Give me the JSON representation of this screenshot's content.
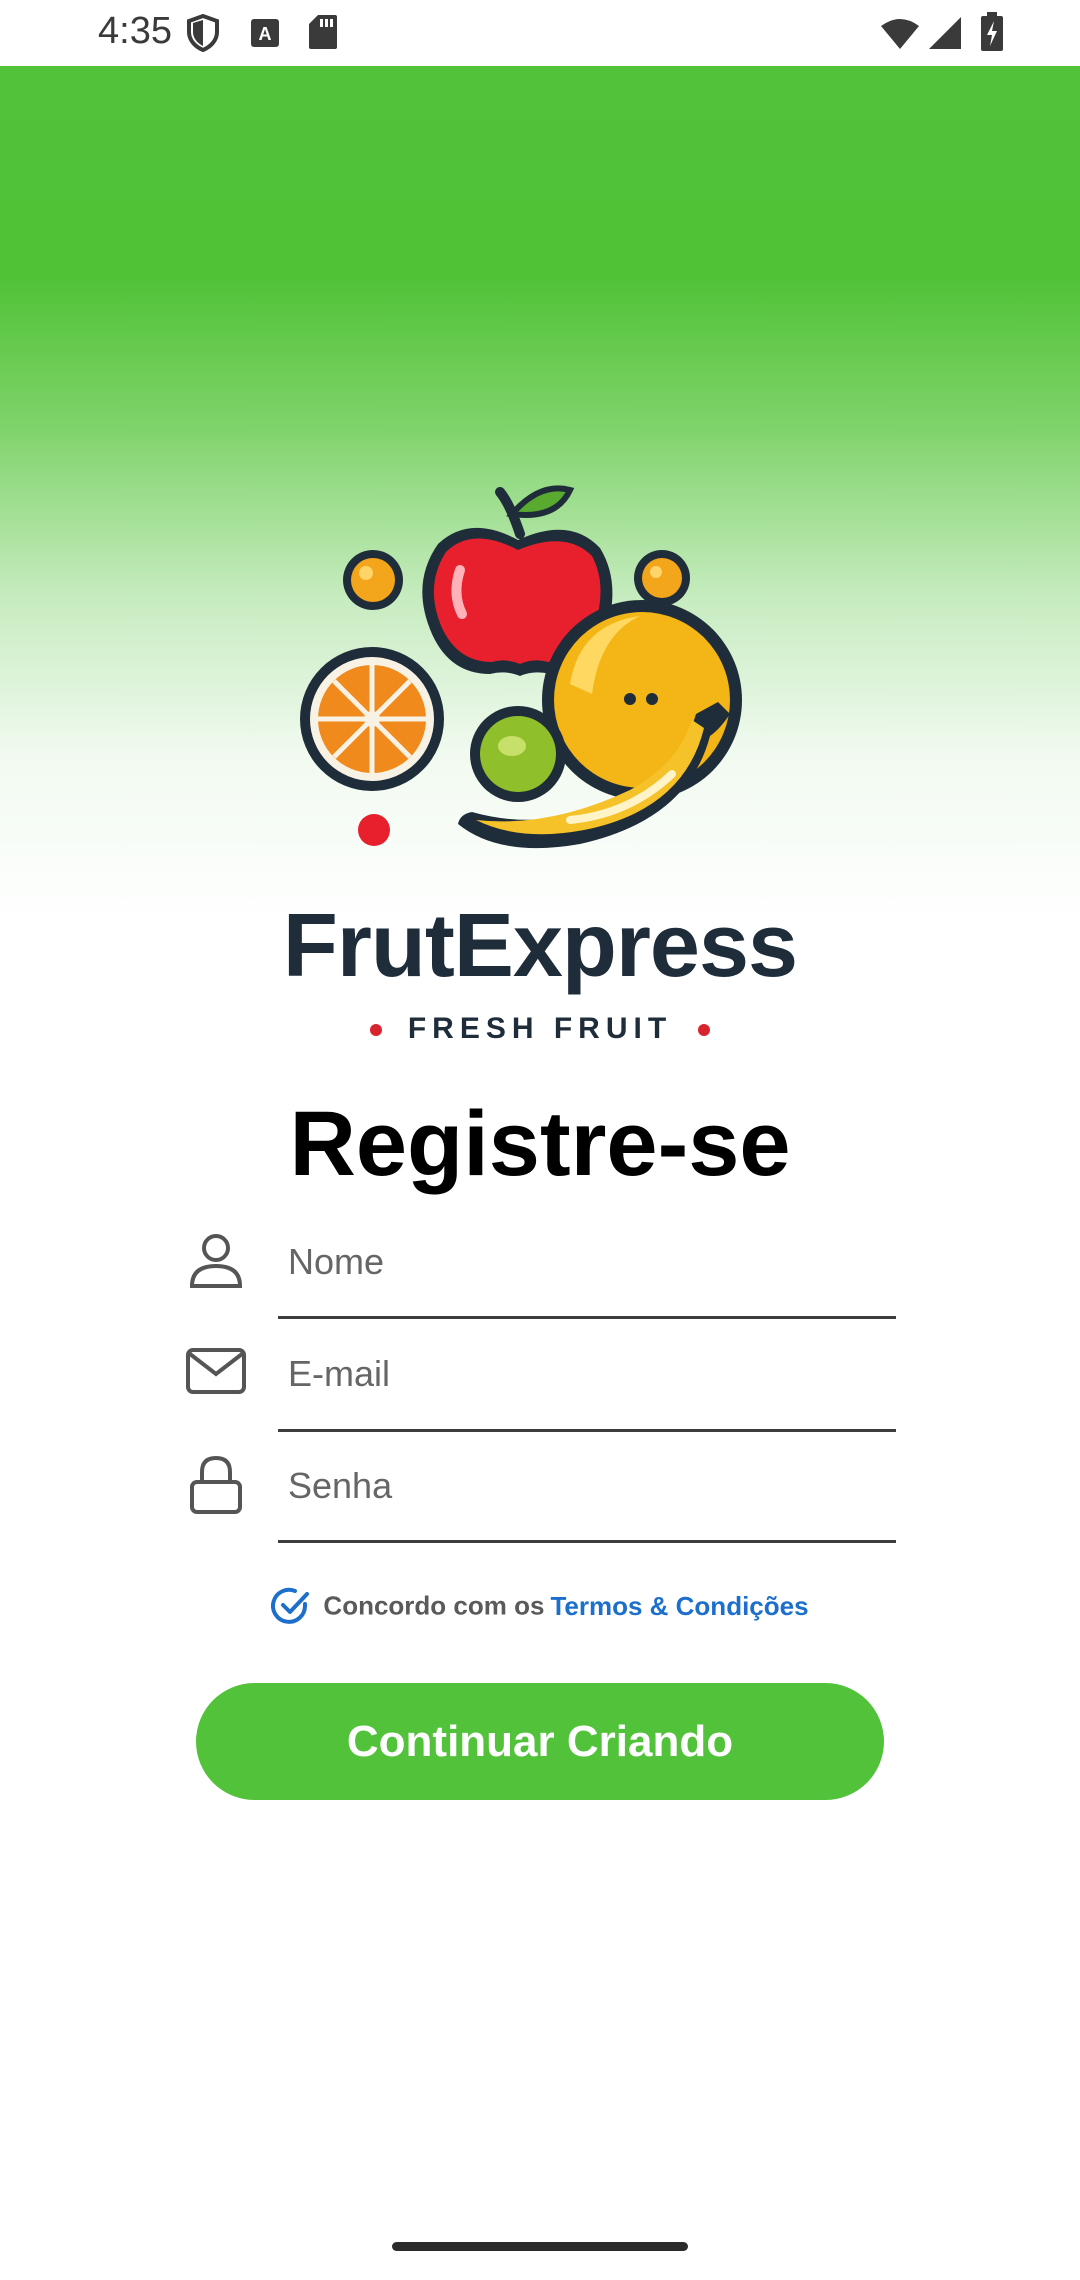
{
  "status_bar": {
    "time": "4:35",
    "icons_left": [
      "shield-icon",
      "a-notification-icon",
      "sd-card-icon"
    ],
    "icons_right": [
      "wifi-icon",
      "signal-icon",
      "battery-charging-icon"
    ]
  },
  "hero": {
    "background_colors": [
      "#52c23a",
      "#ffffff"
    ],
    "brand_name": "FrutExpress",
    "tagline": "FRESH FRUIT"
  },
  "form": {
    "title": "Registre-se",
    "fields": [
      {
        "icon": "user-icon",
        "placeholder": "Nome",
        "value": ""
      },
      {
        "icon": "mail-icon",
        "placeholder": "E-mail",
        "value": ""
      },
      {
        "icon": "lock-icon",
        "placeholder": "Senha",
        "value": ""
      }
    ],
    "terms_prefix": "Concordo com os",
    "terms_link": "Termos & Condições",
    "terms_checked": true,
    "submit_label": "Continuar Criando"
  },
  "colors": {
    "accent_green": "#52c23a",
    "link_blue": "#1d6fcc",
    "brand_dark": "#1f2d3a"
  }
}
